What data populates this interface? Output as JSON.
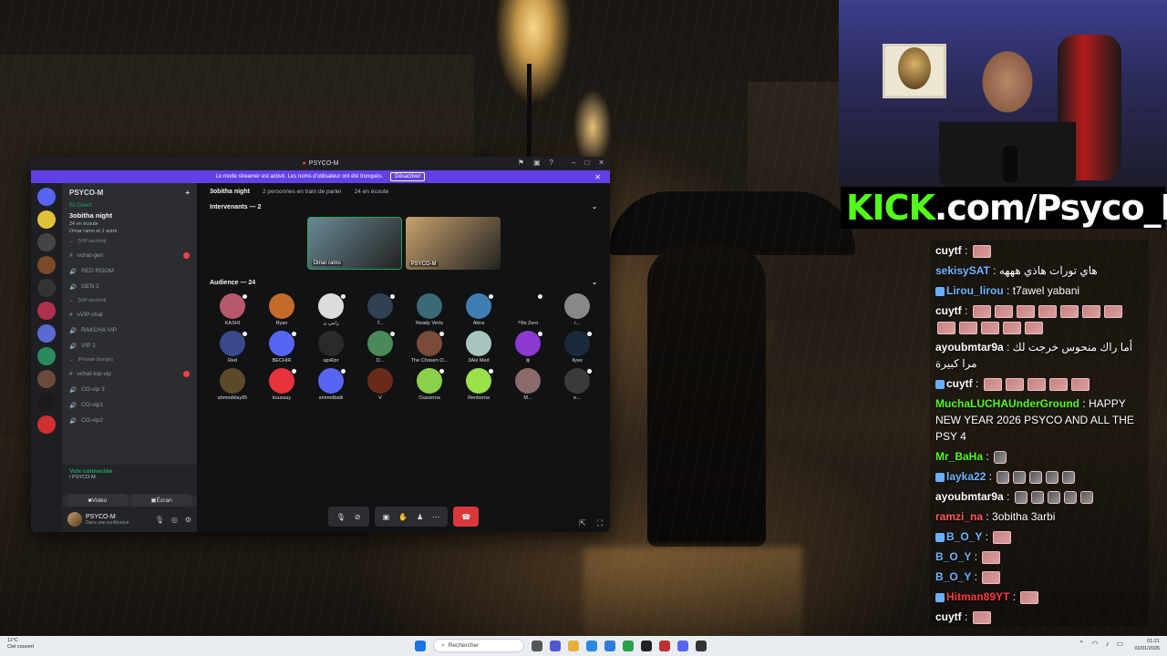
{
  "discord": {
    "window_title": "PSYCO-M",
    "banner_text": "Le mode streamer est activé. Les noms d'utilisateur ont été tronqués.",
    "banner_button": "Désactiver",
    "server_name": "PSYCO-M",
    "live_label": "En Direct",
    "stage_title": "3obitha night",
    "stage_listening": "24 en écoute",
    "stage_speakers_line": "Omar ramo et 1 autre",
    "channels": [
      {
        "kind": "category",
        "label": "[VIP section]"
      },
      {
        "kind": "text",
        "label": "vchat-gen",
        "unread": true
      },
      {
        "kind": "voice",
        "label": "RED ROOM"
      },
      {
        "kind": "voice",
        "label": "GEN 2"
      },
      {
        "kind": "category",
        "label": "[VIP section]"
      },
      {
        "kind": "text",
        "label": "vVIP-chat"
      },
      {
        "kind": "voice",
        "label": "RAKCHA VIP"
      },
      {
        "kind": "voice",
        "label": "VIP 1"
      },
      {
        "kind": "category",
        "label": "[Private lounge]"
      },
      {
        "kind": "text",
        "label": "vchat-top-vip",
        "unread": true
      },
      {
        "kind": "voice",
        "label": "CO-vip 3"
      },
      {
        "kind": "voice",
        "label": "CO-vip1"
      },
      {
        "kind": "voice",
        "label": "CO-vip2"
      }
    ],
    "voice_connected_label": "Voix connectée",
    "voice_connected_sub": "/ PSYCO-M",
    "video_button": "Vidéo",
    "screen_button": "Écran",
    "user_name": "PSYCO-M",
    "user_status": "Dans une conférence",
    "header": {
      "stage": "3obitha night",
      "speaking": "2 personnes en train de parler",
      "listening": "24 en écoute"
    },
    "speakers_title": "Intervenants — 2",
    "speakers": [
      {
        "name": "Omar ramo",
        "color": "#6a8a95"
      },
      {
        "name": "PSYCO-M",
        "color": "#c9a26d"
      }
    ],
    "audience_title": "Audience — 24",
    "audience": [
      {
        "name": "KASHI",
        "color": "#b7596a"
      },
      {
        "name": "Ryan",
        "color": "#c46b2a"
      },
      {
        "name": "رامي ن",
        "color": "#dddddd"
      },
      {
        "name": "T...",
        "color": "#304050"
      },
      {
        "name": "Ready Vertx",
        "color": "#3a6a78"
      },
      {
        "name": "Akira",
        "color": "#3f7eb3"
      },
      {
        "name": "ᴵᵗˢIts Zero",
        "color": "#111111"
      },
      {
        "name": "r...",
        "color": "#888888"
      },
      {
        "name": "Red",
        "color": "#3a4a8a"
      },
      {
        "name": "BECHIR",
        "color": "#5865f2"
      },
      {
        "name": "ɛφ϶Ʀᴅr",
        "color": "#2a2a2a"
      },
      {
        "name": "D...",
        "color": "#4a8a5a"
      },
      {
        "name": "The Chosen O...",
        "color": "#7a4a3a"
      },
      {
        "name": "3Alé Med",
        "color": "#a8c4c0"
      },
      {
        "name": "iiji",
        "color": "#8a3ad0"
      },
      {
        "name": "Ilyes",
        "color": "#1b2a3a"
      },
      {
        "name": "ahmedklay95",
        "color": "#5a4a2a"
      },
      {
        "name": "koussay",
        "color": "#e8323c"
      },
      {
        "name": "ahmedbalti",
        "color": "#5865f2"
      },
      {
        "name": "V",
        "color": "#6a2a1a"
      },
      {
        "name": "Oussema",
        "color": "#8ad04a"
      },
      {
        "name": "Renbema",
        "color": "#9ae04a"
      },
      {
        "name": "M...",
        "color": "#8a6a6a"
      },
      {
        "name": "e...",
        "color": "#3a3a3a"
      }
    ]
  },
  "kick_banner": {
    "kick": "KICK",
    "rest": ".com/Psyco_M"
  },
  "chat": [
    {
      "user": "cuytf",
      "color": "#ffffff",
      "text": "",
      "emotes": 1
    },
    {
      "user": "sekisySAT",
      "color": "#6fb6ff",
      "text": "هاي تورات هاذي هههه",
      "emotes": 0
    },
    {
      "user": "Lirou_lirou",
      "color": "#6fb6ff",
      "text": "t7awel yabani",
      "emotes": 0
    },
    {
      "user": "cuytf",
      "color": "#ffffff",
      "text": "",
      "emotes": 12
    },
    {
      "user": "ayoubmtar9a",
      "color": "#ffffff",
      "text": "أما راك منحوس خرجت لك مرا كبيرة",
      "emotes": 0
    },
    {
      "user": "cuytf",
      "color": "#ffffff",
      "text": "",
      "emotes": 5
    },
    {
      "user": "MuchaLUCHAUnderGround",
      "color": "#53fc18",
      "text": "HAPPY NEW YEAR 2026 PSYCO AND ALL THE PSY 4",
      "emotes": 0
    },
    {
      "user": "Mr_BaHa",
      "color": "#53fc18",
      "text": "",
      "emotes": 1
    },
    {
      "user": "layka22",
      "color": "#6fb6ff",
      "text": "",
      "emotes": 5
    },
    {
      "user": "ayoubmtar9a",
      "color": "#ffffff",
      "text": "",
      "emotes": 5
    },
    {
      "user": "ramzi_na",
      "color": "#ff5b5b",
      "text": "3obitha 3arbi",
      "emotes": 0
    },
    {
      "user": "B_O_Y",
      "color": "#6fb6ff",
      "text": "",
      "emotes": 1
    },
    {
      "user": "B_O_Y",
      "color": "#6fb6ff",
      "text": "",
      "emotes": 1
    },
    {
      "user": "B_O_Y",
      "color": "#6fb6ff",
      "text": "",
      "emotes": 1
    },
    {
      "user": "Hitman89YT",
      "color": "#ff3b3b",
      "text": "",
      "emotes": 1
    },
    {
      "user": "cuytf",
      "color": "#ffffff",
      "text": "",
      "emotes": 1
    }
  ],
  "taskbar": {
    "weather_temp": "11°C",
    "weather_desc": "Ciel couvert",
    "search_placeholder": "Rechercher",
    "time": "01:21",
    "date": "01/01/2026"
  }
}
